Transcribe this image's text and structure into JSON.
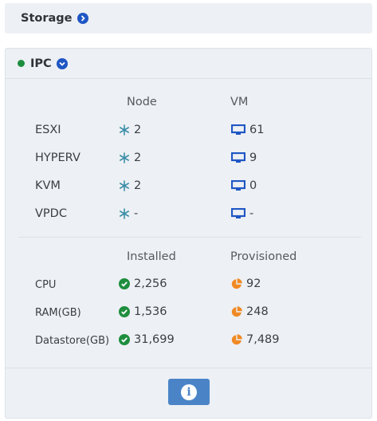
{
  "storage": {
    "title": "Storage"
  },
  "ipc": {
    "title": "IPC",
    "status_color": "#1e8e3e",
    "hypervisors": {
      "headers": {
        "node": "Node",
        "vm": "VM"
      },
      "rows": [
        {
          "name": "ESXI",
          "node": "2",
          "vm": "61"
        },
        {
          "name": "HYPERV",
          "node": "2",
          "vm": "9"
        },
        {
          "name": "KVM",
          "node": "2",
          "vm": "0"
        },
        {
          "name": "VPDC",
          "node": "-",
          "vm": "-"
        }
      ]
    },
    "resources": {
      "headers": {
        "installed": "Installed",
        "provisioned": "Provisioned"
      },
      "rows": [
        {
          "name": "CPU",
          "installed": "2,256",
          "provisioned": "92"
        },
        {
          "name": "RAM(GB)",
          "installed": "1,536",
          "provisioned": "248"
        },
        {
          "name": "Datastore(GB)",
          "installed": "31,699",
          "provisioned": "7,489"
        }
      ]
    },
    "colors": {
      "accent_blue": "#1f56c4",
      "installed_green": "#1e8e3e",
      "provisioned_orange": "#f08a24",
      "info_button": "#4a84c7"
    }
  }
}
